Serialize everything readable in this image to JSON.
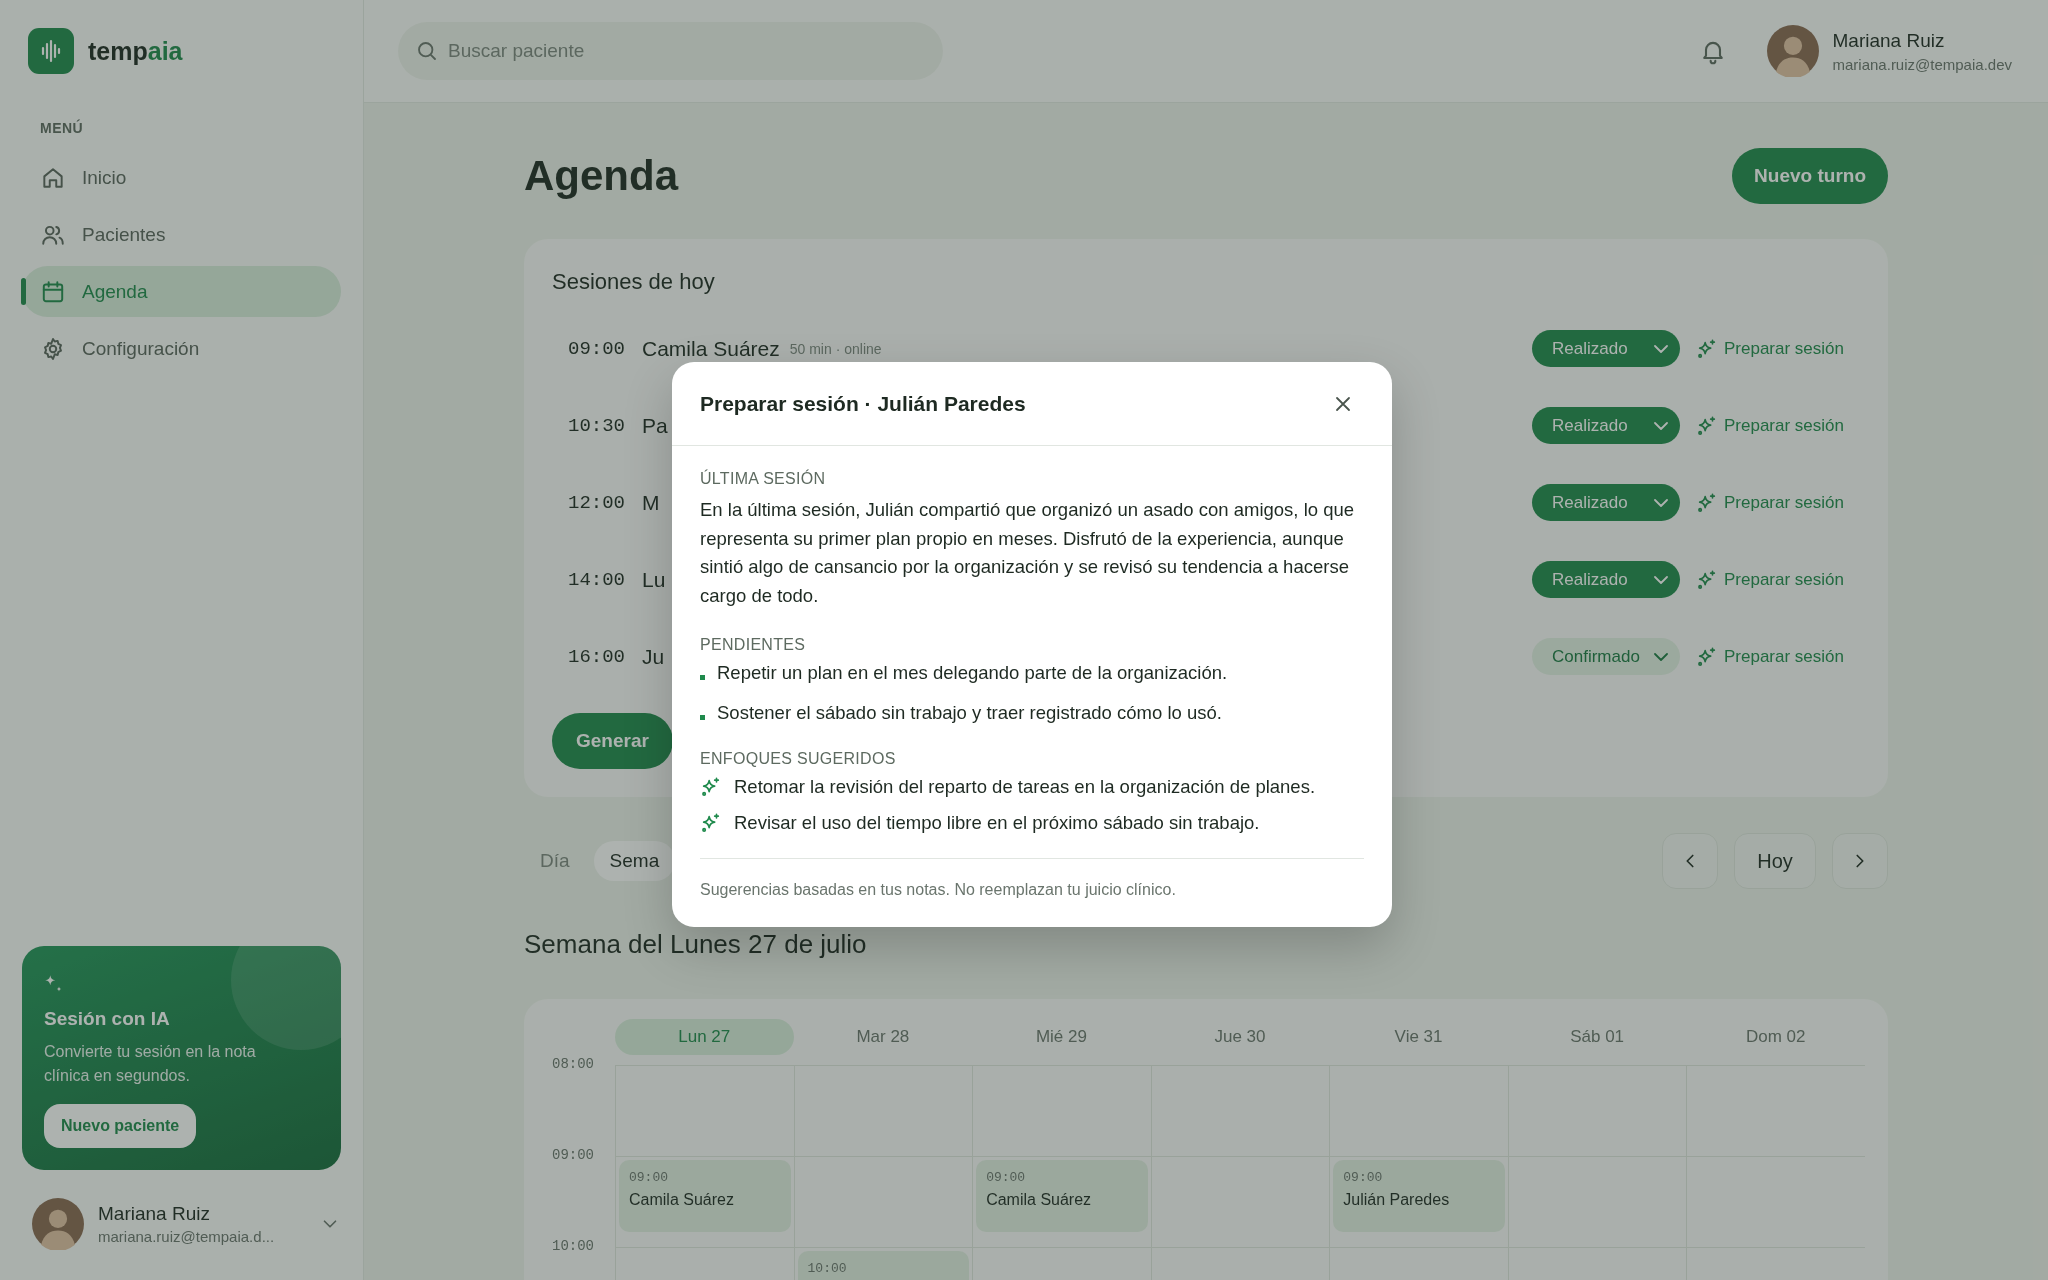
{
  "brand": {
    "name": "temp",
    "accent": "aia"
  },
  "search": {
    "placeholder": "Buscar paciente"
  },
  "user": {
    "name": "Mariana Ruiz",
    "email": "mariana.ruiz@tempaia.dev"
  },
  "sidebar": {
    "heading": "MENÚ",
    "items": [
      {
        "label": "Inicio",
        "selected": false
      },
      {
        "label": "Pacientes",
        "selected": false
      },
      {
        "label": "Agenda",
        "selected": true
      },
      {
        "label": "Configuración",
        "selected": false
      }
    ]
  },
  "promo": {
    "title": "Sesión con IA",
    "text": "Convierte tu sesión en la nota clínica en segundos.",
    "button": "Nuevo paciente"
  },
  "sidebar_user": {
    "name": "Mariana Ruiz",
    "email": "mariana.ruiz@tempaia.d..."
  },
  "page": {
    "title": "Agenda",
    "new_button": "Nuevo turno"
  },
  "sessions": {
    "title": "Sesiones de hoy",
    "button": "Generar",
    "rows": [
      {
        "time": "09:00",
        "patient": "Camila Suárez",
        "meta": "50 min · online",
        "status": "Realizado",
        "kind": "done",
        "action": "Preparar sesión"
      },
      {
        "time": "10:30",
        "patient": "Pa",
        "status": "Realizado",
        "kind": "done",
        "action": "Preparar sesión"
      },
      {
        "time": "12:00",
        "patient": "M",
        "status": "Realizado",
        "kind": "done",
        "action": "Preparar sesión"
      },
      {
        "time": "14:00",
        "patient": "Lu",
        "status": "Realizado",
        "kind": "done",
        "action": "Preparar sesión"
      },
      {
        "time": "16:00",
        "patient": "Ju",
        "status": "Confirmado",
        "kind": "confirmed",
        "action": "Preparar sesión"
      }
    ]
  },
  "view_tabs": [
    {
      "label": "Día",
      "selected": false
    },
    {
      "label": "Sema",
      "selected": true
    }
  ],
  "nav": {
    "today": "Hoy"
  },
  "week": {
    "title": "Semana del Lunes 27 de julio",
    "days": [
      {
        "label": "Lun 27",
        "selected": true
      },
      {
        "label": "Mar 28",
        "selected": false
      },
      {
        "label": "Mié 29",
        "selected": false
      },
      {
        "label": "Jue 30",
        "selected": false
      },
      {
        "label": "Vie 31",
        "selected": false
      },
      {
        "label": "Sáb 01",
        "selected": false
      },
      {
        "label": "Dom 02",
        "selected": false
      }
    ],
    "rows": [
      {
        "hour": "08:00",
        "cells": [
          {
            "kind": "empty"
          },
          {
            "kind": "empty"
          },
          {
            "kind": "empty"
          },
          {
            "kind": "empty"
          },
          {
            "kind": "empty"
          },
          {
            "kind": "empty"
          },
          {
            "kind": "empty"
          }
        ]
      },
      {
        "hour": "09:00",
        "cells": [
          {
            "kind": "event",
            "time": "09:00",
            "patient": "Camila Suárez"
          },
          {
            "kind": "empty"
          },
          {
            "kind": "event",
            "time": "09:00",
            "patient": "Camila Suárez"
          },
          {
            "kind": "empty"
          },
          {
            "kind": "event",
            "time": "09:00",
            "patient": "Julián Paredes"
          },
          {
            "kind": "empty"
          },
          {
            "kind": "empty"
          }
        ]
      },
      {
        "hour": "10:00",
        "cells": [
          {
            "kind": "empty"
          },
          {
            "kind": "event",
            "time": "10:00"
          },
          {
            "kind": "empty"
          },
          {
            "kind": "empty"
          },
          {
            "kind": "empty"
          },
          {
            "kind": "empty"
          },
          {
            "kind": "empty"
          }
        ]
      }
    ]
  },
  "modal": {
    "title": "Preparar sesión · Julián Paredes",
    "sections": [
      {
        "heading": "ÚLTIMA SESIÓN",
        "kind": "text",
        "text": "En la última sesión, Julián compartió que organizó un asado con amigos, lo que representa su primer plan propio en meses. Disfrutó de la experiencia, aunque sintió algo de cansancio por la organización y se revisó su tendencia a hacerse cargo de todo."
      },
      {
        "heading": "PENDIENTES",
        "kind": "bullets",
        "items": [
          "Repetir un plan en el mes delegando parte de la organización.",
          "Sostener el sábado sin trabajo y traer registrado cómo lo usó."
        ]
      },
      {
        "heading": "ENFOQUES SUGERIDOS",
        "kind": "suggestions",
        "items": [
          "Retomar la revisión del reparto de tareas en la organización de planes.",
          "Revisar el uso del tiempo libre en el próximo sábado sin trabajo."
        ]
      }
    ],
    "footnote": "Sugerencias basadas en tus notas. No reemplazan tu juicio clínico."
  }
}
